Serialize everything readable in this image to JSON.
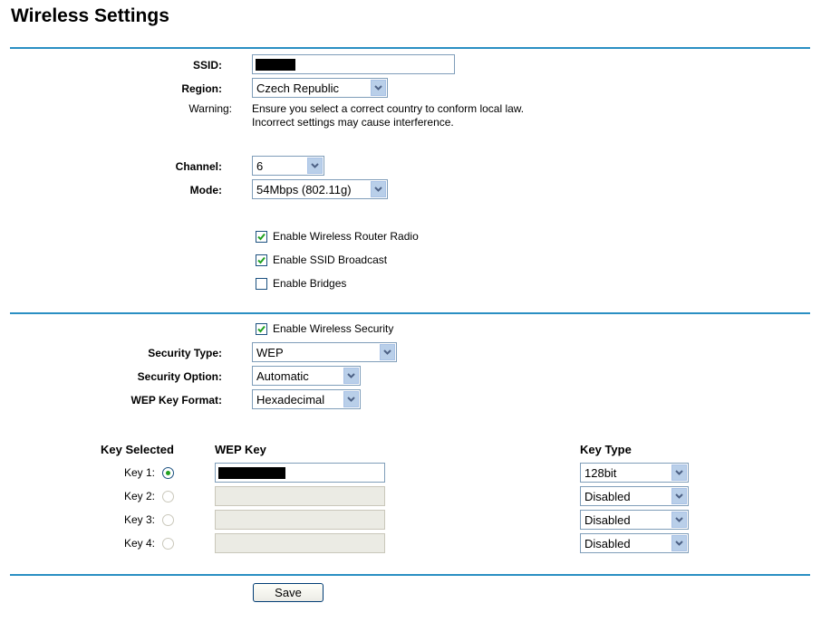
{
  "page": {
    "title": "Wireless Settings"
  },
  "basic": {
    "ssid_label": "SSID:",
    "region_label": "Region:",
    "region_value": "Czech Republic",
    "warning_label": "Warning:",
    "warning_line1": "Ensure you select a correct country to conform local law.",
    "warning_line2": "Incorrect settings may cause interference.",
    "channel_label": "Channel:",
    "channel_value": "6",
    "mode_label": "Mode:",
    "mode_value": "54Mbps (802.11g)"
  },
  "options": {
    "radio": {
      "label": "Enable Wireless Router Radio",
      "checked": true
    },
    "ssid_broadcast": {
      "label": "Enable SSID Broadcast",
      "checked": true
    },
    "bridges": {
      "label": "Enable Bridges",
      "checked": false
    }
  },
  "security": {
    "enable_label": "Enable Wireless Security",
    "enable_checked": true,
    "type_label": "Security Type:",
    "type_value": "WEP",
    "option_label": "Security Option:",
    "option_value": "Automatic",
    "format_label": "WEP Key Format:",
    "format_value": "Hexadecimal"
  },
  "keys": {
    "col_selected": "Key Selected",
    "col_key": "WEP Key",
    "col_type": "Key Type",
    "rows": [
      {
        "label": "Key 1:",
        "selected": true,
        "enabled": true,
        "type": "128bit"
      },
      {
        "label": "Key 2:",
        "selected": false,
        "enabled": false,
        "type": "Disabled"
      },
      {
        "label": "Key 3:",
        "selected": false,
        "enabled": false,
        "type": "Disabled"
      },
      {
        "label": "Key 4:",
        "selected": false,
        "enabled": false,
        "type": "Disabled"
      }
    ]
  },
  "actions": {
    "save_label": "Save"
  },
  "colors": {
    "rule": "#2a8fc3",
    "select_arrow_bg": "#b9cfe9",
    "checkmark": "#21a121"
  },
  "icons": {
    "dropdown": "chevron-down-icon",
    "checkbox_check": "check-icon"
  }
}
